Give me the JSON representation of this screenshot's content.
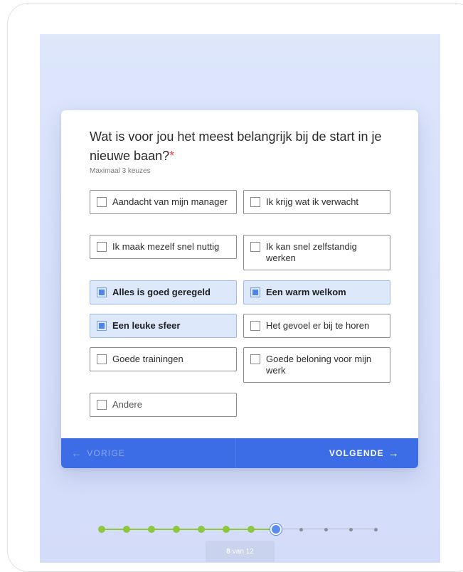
{
  "question": {
    "title": "Wat is voor jou het meest belangrijk bij de start in je nieuwe baan?",
    "required_marker": "*",
    "hint": "Maximaal 3 keuzes"
  },
  "options": [
    {
      "label": "Aandacht van mijn manager",
      "checked": false
    },
    {
      "label": "Ik krijg wat ik verwacht",
      "checked": false
    },
    {
      "label": "Ik maak mezelf snel nuttig",
      "checked": false
    },
    {
      "label": "Ik kan snel zelfstandig werken",
      "checked": false
    },
    {
      "label": "Alles is goed geregeld",
      "checked": true
    },
    {
      "label": "Een warm welkom",
      "checked": true
    },
    {
      "label": "Een leuke sfeer",
      "checked": true
    },
    {
      "label": "Het gevoel er bij te horen",
      "checked": false
    },
    {
      "label": "Goede trainingen",
      "checked": false
    },
    {
      "label": "Goede beloning voor mijn werk",
      "checked": false
    },
    {
      "label": "Andere",
      "checked": false
    }
  ],
  "nav": {
    "prev_label": "VORIGE",
    "next_label": "VOLGENDE",
    "prev_arrow": "←",
    "next_arrow": "→"
  },
  "progress": {
    "current": "8",
    "of_text": "van 12",
    "total_steps": 12,
    "current_step": 8,
    "done_color": "#8dc63f",
    "current_color": "#5b8def",
    "todo_color": "#8a8f9c"
  },
  "colors": {
    "accent": "#3d6de6",
    "required": "#e5484d"
  }
}
